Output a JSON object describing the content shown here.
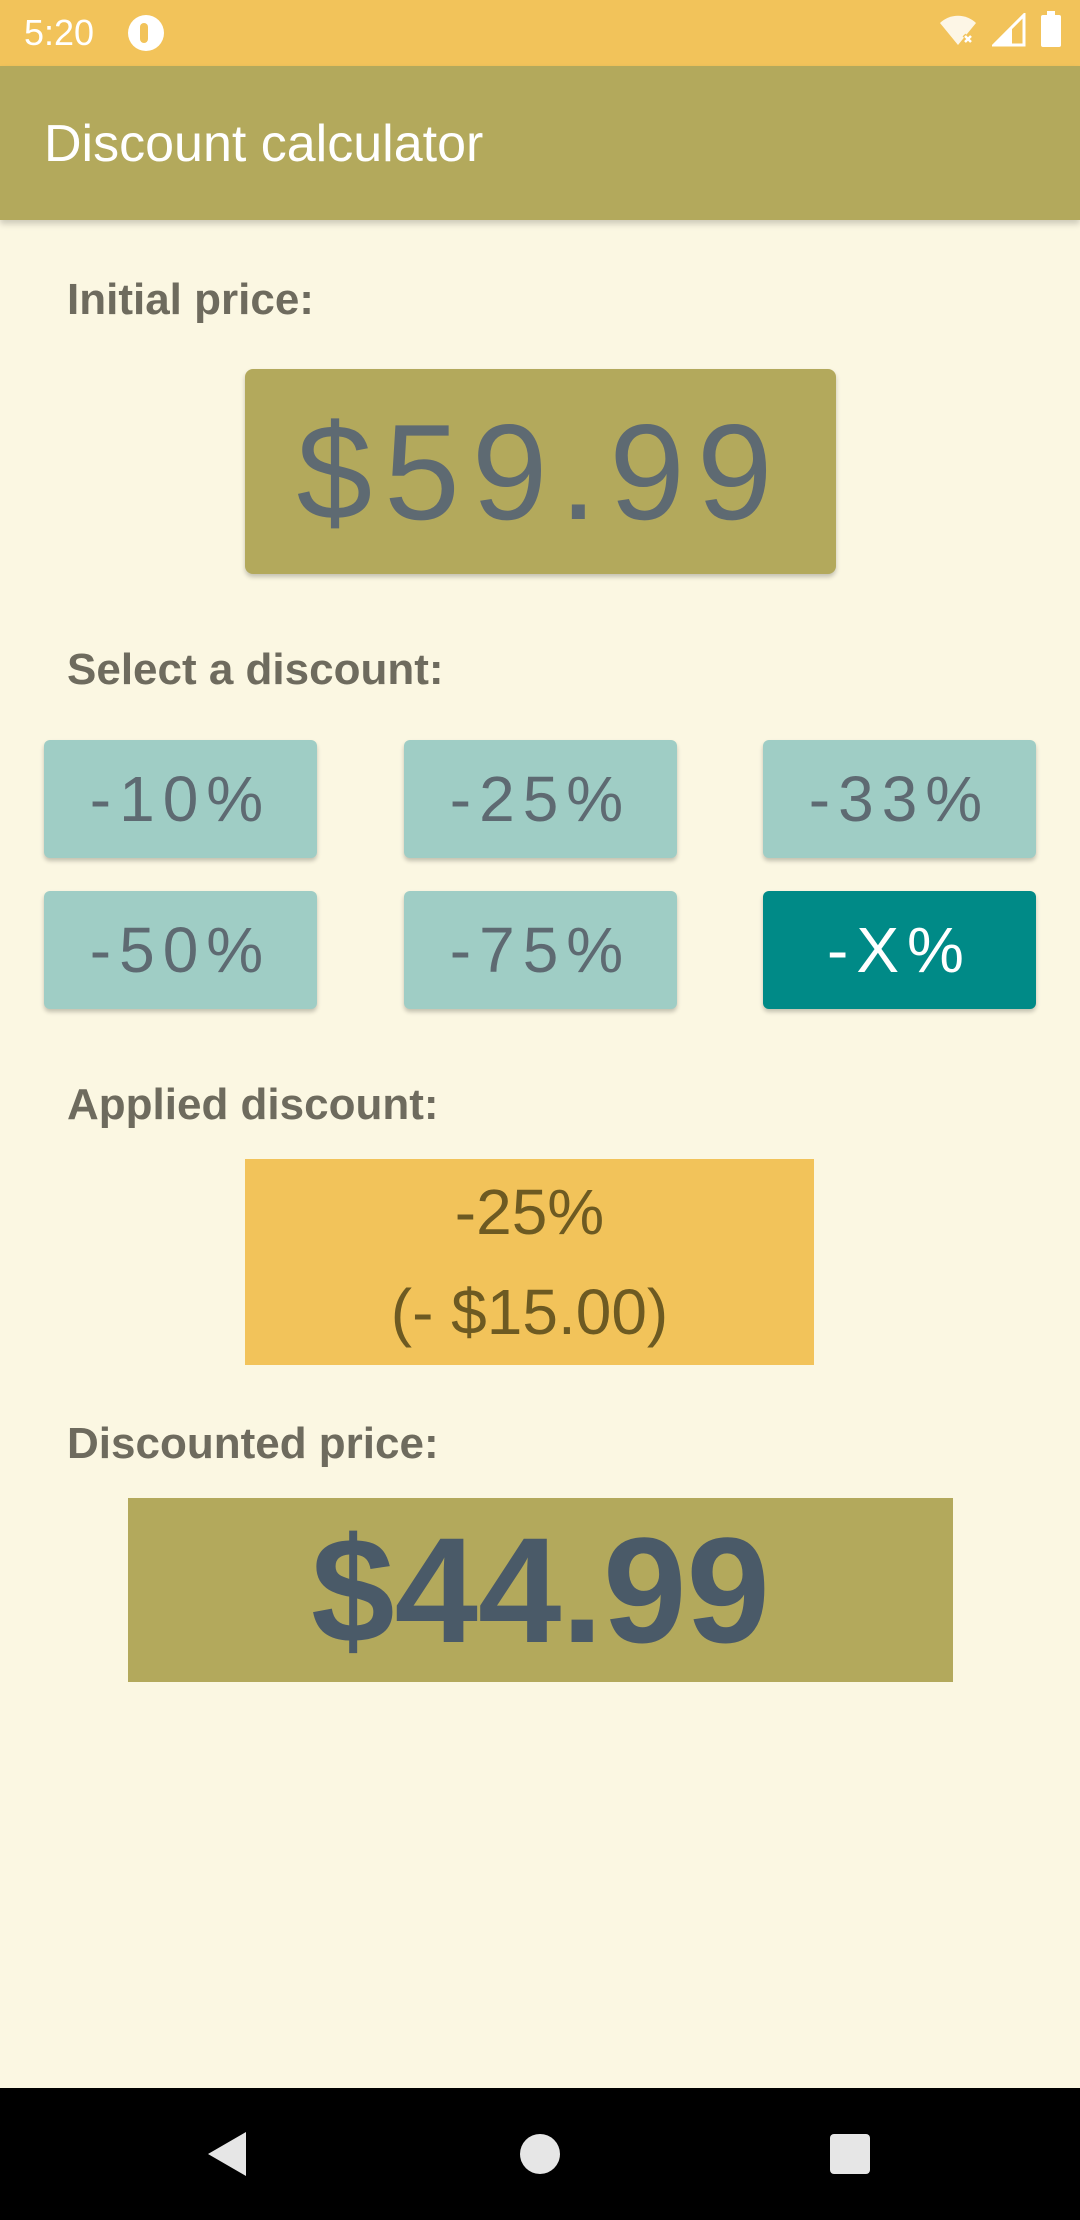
{
  "status_bar": {
    "time": "5:20",
    "icons": [
      "app-notification-icon",
      "wifi-icon",
      "signal-icon",
      "battery-icon"
    ]
  },
  "app_bar": {
    "title": "Discount calculator"
  },
  "initial_price": {
    "label": "Initial price:",
    "value": "$59.99"
  },
  "discount_select": {
    "label": "Select a discount:",
    "options": [
      {
        "label": "-10%",
        "selected": false
      },
      {
        "label": "-25%",
        "selected": false
      },
      {
        "label": "-33%",
        "selected": false
      },
      {
        "label": "-50%",
        "selected": false
      },
      {
        "label": "-75%",
        "selected": false
      },
      {
        "label": "-X%",
        "selected": true
      }
    ]
  },
  "applied_discount": {
    "label": "Applied discount:",
    "percent": "-25%",
    "amount": "(- $15.00)"
  },
  "discounted_price": {
    "label": "Discounted price:",
    "value": "$44.99"
  },
  "nav_bar": {
    "buttons": [
      "back-icon",
      "home-icon",
      "recents-icon"
    ]
  },
  "colors": {
    "status_bar": "#f2c35a",
    "app_bar": "#b3a95c",
    "background": "#fbf7e2",
    "button": "#9fcdc5",
    "button_selected": "#008a87",
    "applied_box": "#f2c35a",
    "price_text": "#5e6a72"
  }
}
